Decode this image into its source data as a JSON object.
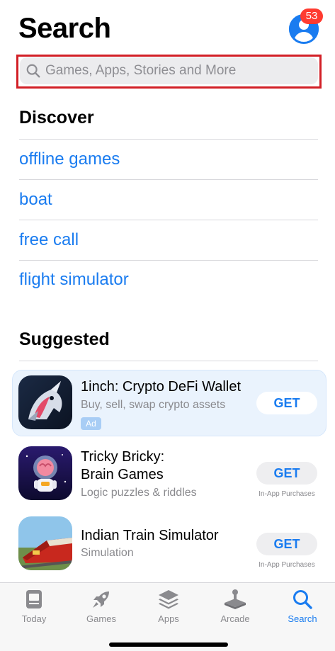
{
  "header": {
    "title": "Search",
    "badge_count": "53"
  },
  "search": {
    "placeholder": "Games, Apps, Stories and More",
    "value": ""
  },
  "discover": {
    "title": "Discover",
    "items": [
      {
        "label": "offline games"
      },
      {
        "label": "boat"
      },
      {
        "label": "free call"
      },
      {
        "label": "flight simulator"
      }
    ]
  },
  "suggested": {
    "title": "Suggested",
    "apps": [
      {
        "name_line1": "1inch: Crypto DeFi Wallet",
        "name_line2": "",
        "subtitle": "Buy, sell, swap crypto assets",
        "button": "GET",
        "ad_label": "Ad",
        "iap": ""
      },
      {
        "name_line1": "Tricky Bricky:",
        "name_line2": "Brain Games",
        "subtitle": "Logic puzzles & riddles",
        "button": "GET",
        "ad_label": "",
        "iap": "In-App Purchases"
      },
      {
        "name_line1": "Indian Train Simulator",
        "name_line2": "",
        "subtitle": "Simulation",
        "button": "GET",
        "ad_label": "",
        "iap": "In-App Purchases"
      }
    ]
  },
  "tabbar": {
    "tabs": [
      {
        "label": "Today",
        "icon": "today-icon"
      },
      {
        "label": "Games",
        "icon": "rocket-icon"
      },
      {
        "label": "Apps",
        "icon": "layers-icon"
      },
      {
        "label": "Arcade",
        "icon": "joystick-icon"
      },
      {
        "label": "Search",
        "icon": "search-icon"
      }
    ],
    "active": "Search"
  },
  "colors": {
    "accent": "#1a7cf0",
    "badge": "#ff3b30",
    "highlight_outline": "#d21f26"
  }
}
